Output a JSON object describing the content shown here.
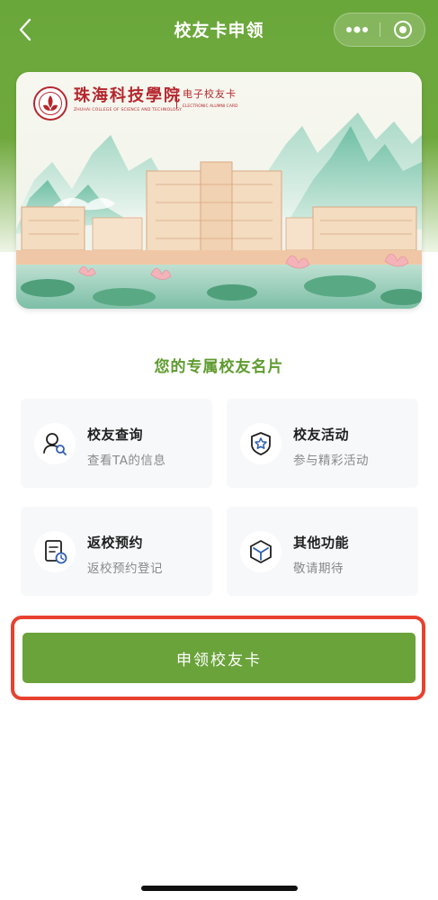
{
  "header": {
    "title": "校友卡申领",
    "back_icon": "chevron-left-icon",
    "more_icon": "more-dots-icon",
    "close_icon": "target-close-icon"
  },
  "card": {
    "school_name_cn": "珠海科技學院",
    "school_name_en": "ZHUHAI COLLEGE OF SCIENCE AND TECHNOLOGY",
    "card_title_cn": "电子校友卡",
    "card_title_en": "ELECTRONIC ALUMNI CARD",
    "seal_icon": "school-seal-icon",
    "brand_color": "#b6262d"
  },
  "section": {
    "heading": "您的专属校友名片"
  },
  "features": [
    {
      "title": "校友查询",
      "subtitle": "查看TA的信息",
      "icon": "user-search-icon"
    },
    {
      "title": "校友活动",
      "subtitle": "参与精彩活动",
      "icon": "star-shield-icon"
    },
    {
      "title": "返校预约",
      "subtitle": "返校预约登记",
      "icon": "calendar-clock-icon"
    },
    {
      "title": "其他功能",
      "subtitle": "敬请期待",
      "icon": "cube-icon"
    }
  ],
  "actions": {
    "apply_label": "申领校友卡"
  },
  "colors": {
    "accent": "#6aa33a",
    "heading": "#5e9b2e",
    "highlight": "#e8412f",
    "icon_blue": "#2f5fb3"
  }
}
